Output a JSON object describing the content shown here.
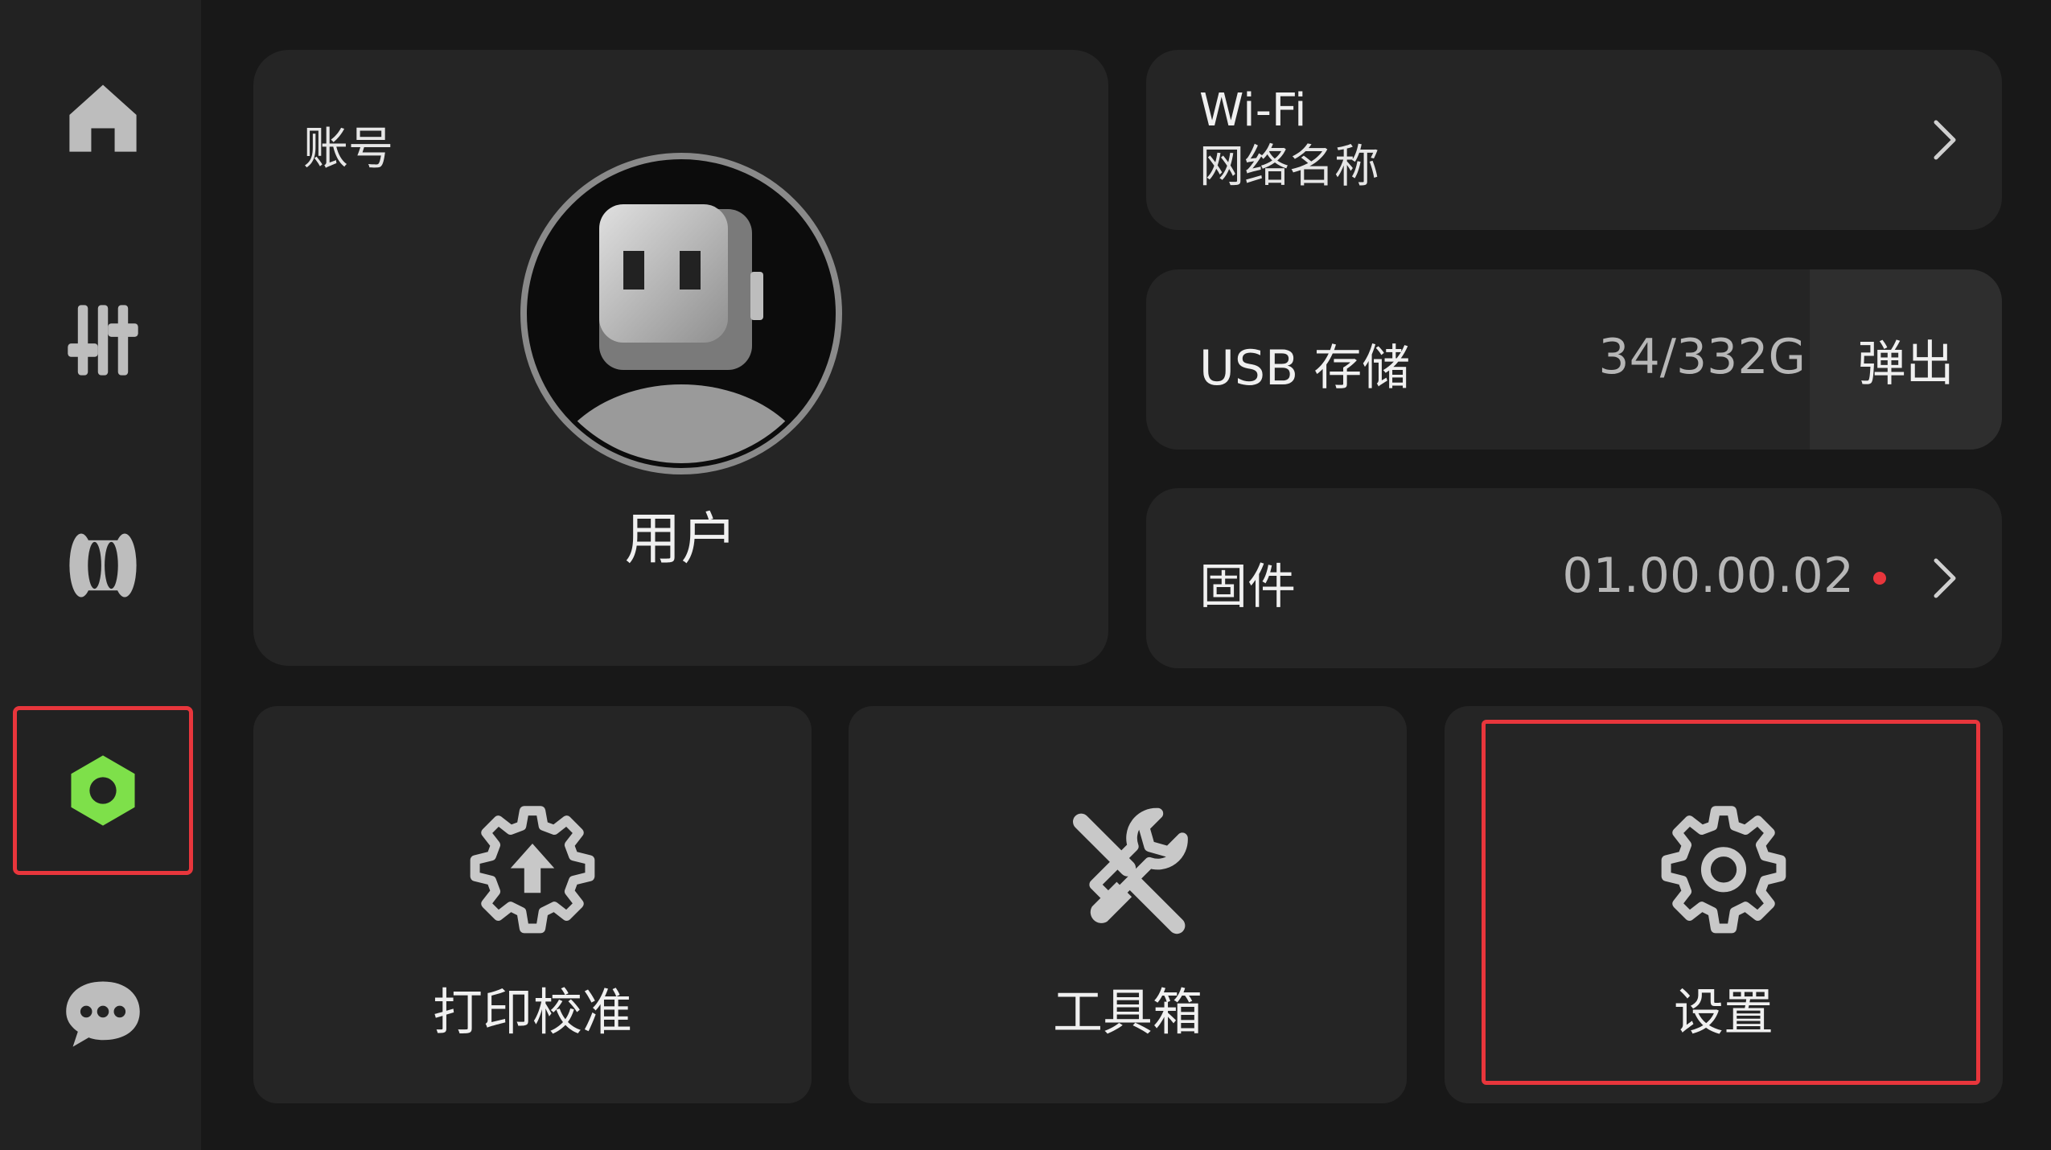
{
  "sidebar": {
    "items": [
      {
        "name": "home",
        "icon": "home-icon",
        "selected": false
      },
      {
        "name": "controls",
        "icon": "sliders-icon",
        "selected": false
      },
      {
        "name": "filament",
        "icon": "filament-spool-icon",
        "selected": false
      },
      {
        "name": "device",
        "icon": "hex-nut-icon",
        "selected": true,
        "color": "#7ee04a"
      },
      {
        "name": "messages",
        "icon": "chat-bubble-icon",
        "selected": false
      }
    ]
  },
  "account": {
    "title": "账号",
    "user_name": "用户",
    "avatar_icon": "robot-avatar-icon"
  },
  "wifi": {
    "label": "Wi-Fi",
    "network_name": "网络名称"
  },
  "usb": {
    "label": "USB 存储",
    "value": "34/332G",
    "eject_label": "弹出"
  },
  "firmware": {
    "label": "固件",
    "version": "01.00.00.02",
    "update_dot_color": "#e8363c"
  },
  "tiles": {
    "calibration": {
      "label": "打印校准",
      "icon": "gear-upload-icon"
    },
    "toolbox": {
      "label": "工具箱",
      "icon": "tools-icon"
    },
    "settings": {
      "label": "设置",
      "icon": "gear-icon"
    }
  },
  "colors": {
    "accent": "#7ee04a",
    "highlight": "#e8363c",
    "card": "#252525",
    "background": "#181818"
  }
}
